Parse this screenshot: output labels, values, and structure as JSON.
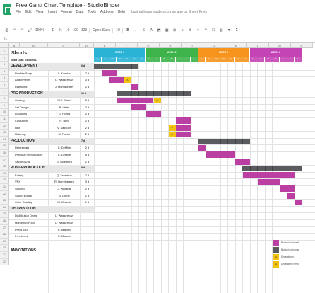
{
  "window": {
    "title": "Free Gantt Chart Template - StudioBinder",
    "menus": [
      "File",
      "Edit",
      "View",
      "Insert",
      "Format",
      "Data",
      "Tools",
      "Add-ons",
      "Help"
    ],
    "last_edit": "Last edit was made seconds ago by Sherri Kreis"
  },
  "toolbar": {
    "zoom": "100%",
    "currency": "$",
    "percent": "%",
    "decimals_less": ".0",
    "decimals_more": ".00",
    "number_format": "123",
    "font": "Open Sans",
    "font_size": "10",
    "bold": "B",
    "italic": "I",
    "strike": "S",
    "text_color": "A"
  },
  "sheet": {
    "col_letters": [
      "A",
      "B",
      "C",
      "D",
      "E",
      "F",
      "G",
      "H",
      "I",
      "J",
      "K",
      "L",
      "M",
      "N"
    ],
    "title": "Shorts",
    "start_date": "Start Date: 04/01/2017",
    "weeks": [
      {
        "label": "WEEK 1",
        "color": "#2bb3d6"
      },
      {
        "label": "WEEK 2",
        "color": "#3db34a"
      },
      {
        "label": "WEEK 3",
        "color": "#f7941d"
      },
      {
        "label": "WEEK 4",
        "color": "#c544b5"
      }
    ],
    "day_letters": [
      "M",
      "T",
      "W",
      "Th",
      "F",
      "S",
      "S"
    ],
    "sections": [
      {
        "name": "DEVELOPMENT",
        "days": "6 d",
        "summary": [
          0,
          6
        ],
        "tasks": [
          {
            "name": "Finalize Script",
            "owner": "L. Kessler",
            "dur": "2 d",
            "bars": [
              [
                1,
                3,
                "task"
              ]
            ]
          },
          {
            "name": "Attachments",
            "owner": "L. Wasserman",
            "dur": "3 d",
            "bars": [
              [
                2,
                4,
                "task"
              ],
              [
                4,
                5,
                "dep"
              ]
            ]
          },
          {
            "name": "Financing",
            "owner": "J. Montgomery",
            "dur": "2 d",
            "bars": [
              [
                5,
                6,
                "task"
              ]
            ]
          }
        ]
      },
      {
        "name": "PRE-PRODUCTION",
        "days": "10 d",
        "summary": [
          3,
          13
        ],
        "tasks": [
          {
            "name": "Casting",
            "owner": "M.J. Slater",
            "dur": "5 d",
            "bars": [
              [
                3,
                8,
                "task"
              ],
              [
                8,
                9,
                "dep"
              ]
            ]
          },
          {
            "name": "Set Design",
            "owner": "B. Lister",
            "dur": "2 d",
            "bars": [
              [
                5,
                7,
                "task"
              ]
            ]
          },
          {
            "name": "Locations",
            "owner": "G. Flores",
            "dur": "2 d",
            "bars": [
              [
                7,
                9,
                "task"
              ]
            ]
          },
          {
            "name": "Costumes",
            "owner": "H. Beto",
            "dur": "2 d",
            "bars": [
              [
                11,
                13,
                "task"
              ]
            ]
          },
          {
            "name": "Hair",
            "owner": "V. Sassoon",
            "dur": "2 d",
            "bars": [
              [
                10,
                11,
                "dep"
              ],
              [
                11,
                13,
                "task"
              ]
            ]
          },
          {
            "name": "Make-up",
            "owner": "M. Factor",
            "dur": "2 d",
            "bars": [
              [
                10,
                11,
                "dep"
              ],
              [
                11,
                13,
                "task"
              ]
            ]
          }
        ]
      },
      {
        "name": "PRODUCTION",
        "days": "7 d",
        "summary": [
          14,
          21
        ],
        "tasks": [
          {
            "name": "Rehearsals",
            "owner": "C. DeMille",
            "dur": "2 d",
            "bars": [
              [
                14,
                15,
                "task"
              ]
            ]
          },
          {
            "name": "Principal Photography",
            "owner": "C. DeMille",
            "dur": "5 d",
            "bars": [
              [
                15,
                19,
                "task"
              ]
            ]
          },
          {
            "name": "Second Unit",
            "owner": "S. Spielberg",
            "dur": "1 d",
            "bars": [
              [
                19,
                21,
                "task"
              ]
            ]
          }
        ]
      },
      {
        "name": "POST-PRODUCTION",
        "days": "8 d",
        "summary": [
          20,
          28
        ],
        "tasks": [
          {
            "name": "Editing",
            "owner": "Q. Tarantino",
            "dur": "7 d",
            "bars": [
              [
                20,
                27,
                "task"
              ]
            ]
          },
          {
            "name": "VFX",
            "owner": "R. Harryhausen",
            "dur": "3 d",
            "bars": [
              [
                22,
                25,
                "task"
              ]
            ]
          },
          {
            "name": "Scoring",
            "owner": "J. Williams",
            "dur": "2 d",
            "bars": [
              [
                25,
                27,
                "task"
              ]
            ]
          },
          {
            "name": "Sound Editing",
            "owner": "B. Dome",
            "dur": "1 d",
            "bars": [
              [
                26,
                27,
                "task"
              ]
            ]
          },
          {
            "name": "Color Grading",
            "owner": "M. Gervais",
            "dur": "1 d",
            "bars": [
              [
                27,
                28,
                "task"
              ]
            ]
          }
        ]
      },
      {
        "name": "DISTRIBUTION",
        "days": "",
        "summary": null,
        "tasks": [
          {
            "name": "Distribution Deals",
            "owner": "L. Wasserman",
            "dur": "",
            "bars": []
          },
          {
            "name": "Marketing Push",
            "owner": "L. Wasserman",
            "dur": "",
            "bars": []
          },
          {
            "name": "Press Tour",
            "owner": "E. Mannix",
            "dur": "",
            "bars": []
          },
          {
            "name": "Premieres",
            "owner": "E. Mannix",
            "dur": "",
            "bars": []
          }
        ]
      }
    ],
    "annotations_label": "ANNOTATIONS",
    "legend": [
      {
        "label": "Blocked out event",
        "color": "#bb3fa3"
      },
      {
        "label": "Blocked out phase",
        "color": "#595b5f"
      },
      {
        "label": "Dependency",
        "color": "#f2c311"
      },
      {
        "label": "Dependent Event",
        "color": "#f2c311"
      }
    ],
    "dep_mark": "A"
  }
}
